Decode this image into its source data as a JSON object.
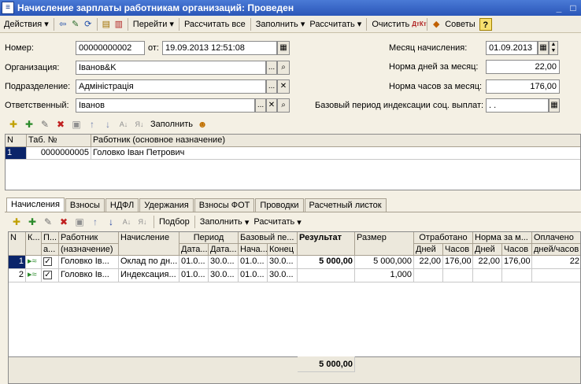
{
  "window": {
    "title": "Начисление зарплаты работникам организаций: Проведен",
    "sys_icon": "doc-icon"
  },
  "toolbar": {
    "actions_label": "Действия",
    "goto_label": "Перейти",
    "calc_all_label": "Рассчитать все",
    "fill_label": "Заполнить",
    "calc_label": "Рассчитать",
    "clear_label": "Очистить",
    "tips_label": "Советы"
  },
  "form": {
    "number_label": "Номер:",
    "number_value": "00000000002",
    "from_label": "от:",
    "date_value": "19.09.2013 12:51:08",
    "org_label": "Организация:",
    "org_value": "Іванов&K",
    "dept_label": "Подразделение:",
    "dept_value": "Адміністрація",
    "resp_label": "Ответственный:",
    "resp_value": "Іванов",
    "month_label": "Месяц начисления:",
    "month_value": "01.09.2013",
    "days_norm_label": "Норма дней за месяц:",
    "days_norm_value": "22,00",
    "hours_norm_label": "Норма часов за месяц:",
    "hours_norm_value": "176,00",
    "base_period_label": "Базовый период индексации соц. выплат:",
    "base_period_value": " .  ."
  },
  "employees": {
    "fill_label": "Заполнить",
    "headers": [
      "N",
      "Таб. №",
      "Работник (основное назначение)"
    ],
    "rows": [
      {
        "n": "1",
        "tab": "0000000005",
        "name": "Головко  Іван Петрович"
      }
    ]
  },
  "tabs": [
    "Начисления",
    "Взносы",
    "НДФЛ",
    "Удержания",
    "Взносы ФОТ",
    "Проводки",
    "Расчетный листок"
  ],
  "accruals": {
    "pick_label": "Подбор",
    "fill_label": "Заполнить",
    "calc_label": "Расчитать",
    "headers": {
      "n": "N",
      "k": "К...",
      "p": "П...",
      "p2": "а...",
      "worker1": "Работник",
      "worker2": "(назначение)",
      "accrual": "Начисление",
      "period": "Период",
      "period_from": "Дата...",
      "period_to": "Дата...",
      "base": "Базовый пе...",
      "base_from": "Нача...",
      "base_to": "Конец",
      "result": "Результат",
      "size": "Размер",
      "worked": "Отработано",
      "worked_days": "Дней",
      "worked_hours": "Часов",
      "norm": "Норма за м...",
      "norm_days": "Дней",
      "norm_hours": "Часов",
      "paid1": "Оплачено",
      "paid2": "дней/часов"
    },
    "rows": [
      {
        "n": "1",
        "worker": "Головко  Ів...",
        "accrual": "Оклад по дн...",
        "from": "01.0...",
        "to": "30.0...",
        "bfrom": "01.0...",
        "bto": "30.0...",
        "result": "5 000,00",
        "size": "5 000,000",
        "wd": "22,00",
        "wh": "176,00",
        "nd": "22,00",
        "nh": "176,00",
        "paid": "22"
      },
      {
        "n": "2",
        "worker": "Головко  Ів...",
        "accrual": "Индексация...",
        "from": "01.0...",
        "to": "30.0...",
        "bfrom": "01.0...",
        "bto": "30.0...",
        "result": "",
        "size": "1,000",
        "wd": "",
        "wh": "",
        "nd": "",
        "nh": "",
        "paid": ""
      }
    ],
    "total_result": "5 000,00"
  }
}
